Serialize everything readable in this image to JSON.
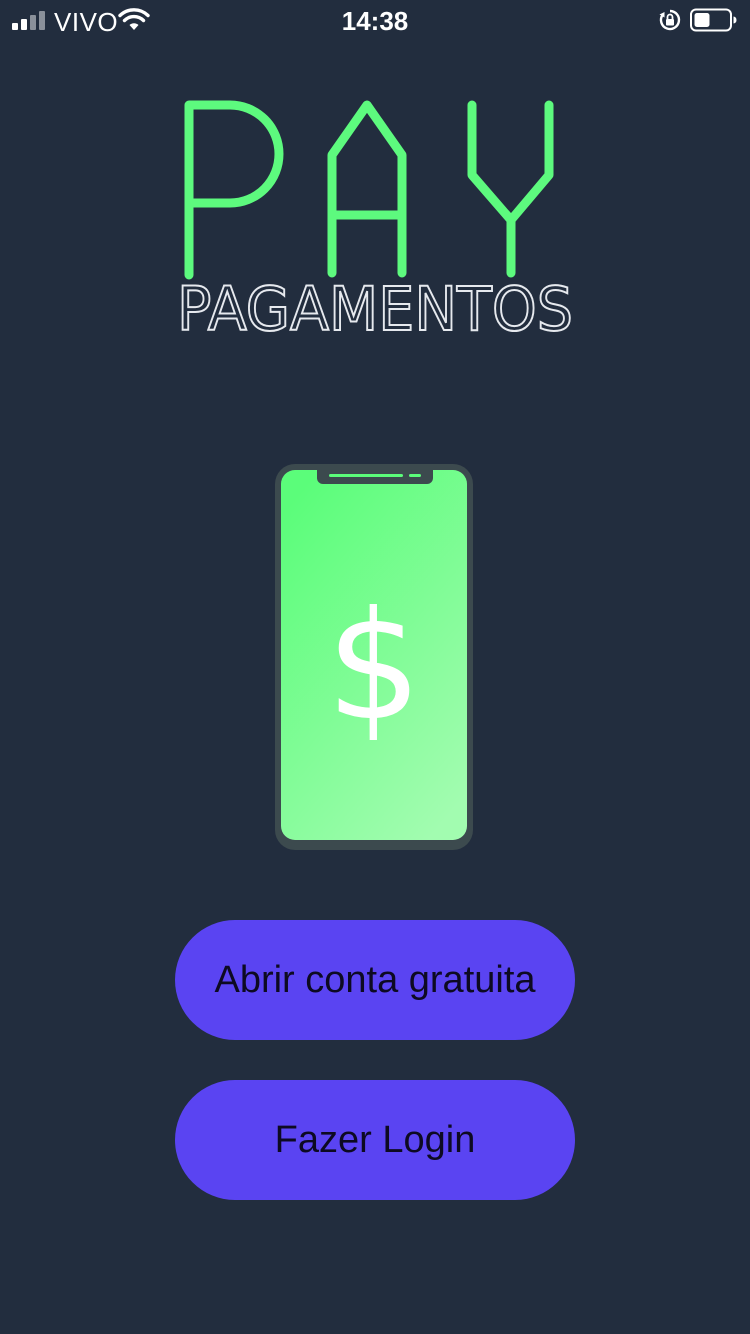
{
  "status_bar": {
    "carrier": "VIVO",
    "time": "14:38",
    "icons": [
      "signal-icon",
      "wifi-icon",
      "rotation-lock-icon",
      "battery-icon"
    ]
  },
  "logo": {
    "title": "PAY",
    "subtitle": "PAGAMENTOS",
    "title_color": "#5dfa7e",
    "subtitle_color": "#e6e9ee"
  },
  "illustration": {
    "icon": "smartphone-icon",
    "symbol": "$",
    "screen_gradient": [
      "#5bfd7a",
      "#a2fcb0"
    ]
  },
  "actions": {
    "open_account_label": "Abrir conta gratuita",
    "login_label": "Fazer Login"
  },
  "colors": {
    "background": "#222d3e",
    "button": "#5a44f2",
    "button_text": "#0d0a22"
  }
}
